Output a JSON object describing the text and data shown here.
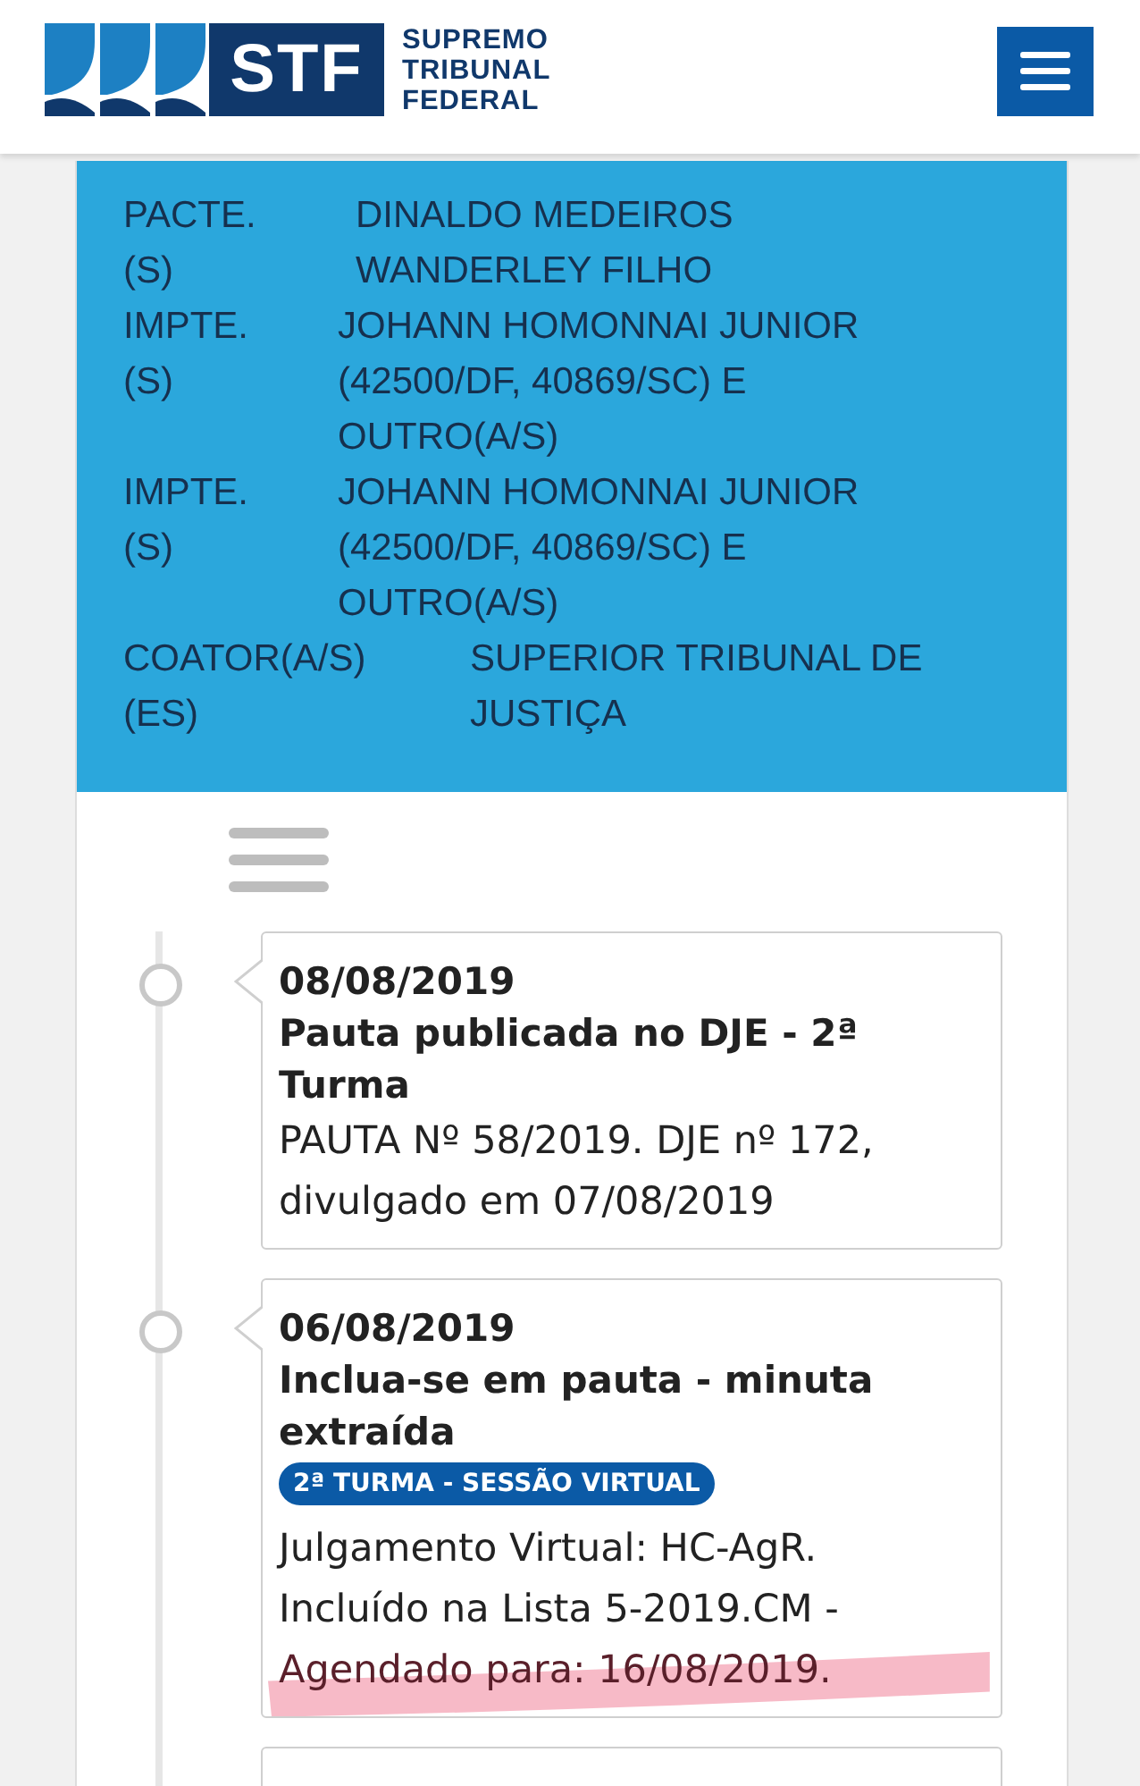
{
  "header": {
    "logo": {
      "abbr": "STF",
      "name_lines": [
        "SUPREMO",
        "TRIBUNAL",
        "FEDERAL"
      ]
    }
  },
  "parties": [
    {
      "label_lines": [
        "PACTE.",
        "(S)"
      ],
      "value_lines": [
        "DINALDO MEDEIROS",
        "WANDERLEY FILHO"
      ]
    },
    {
      "label_lines": [
        "IMPTE.",
        "(S)"
      ],
      "value_lines": [
        "JOHANN HOMONNAI JUNIOR",
        "(42500/DF, 40869/SC) E",
        "OUTRO(A/S)"
      ]
    },
    {
      "label_lines": [
        "IMPTE.",
        "(S)"
      ],
      "value_lines": [
        "JOHANN HOMONNAI JUNIOR",
        "(42500/DF, 40869/SC) E",
        "OUTRO(A/S)"
      ]
    },
    {
      "label_lines": [
        "COATOR(A/S)",
        "(ES)"
      ],
      "value_lines": [
        "SUPERIOR TRIBUNAL DE",
        "JUSTIÇA"
      ]
    }
  ],
  "events": [
    {
      "date": "08/08/2019",
      "title": "Pauta publicada no DJE - 2ª Turma",
      "lines": [
        {
          "text": "PAUTA Nº 58/2019. DJE nº 172,",
          "highlighted": false
        },
        {
          "text": "divulgado em 07/08/2019",
          "highlighted": false
        }
      ]
    },
    {
      "date": "06/08/2019",
      "title": "Inclua-se em pauta - minuta extraída",
      "badge": "2ª TURMA - SESSÃO VIRTUAL",
      "lines": [
        {
          "text": "Julgamento Virtual: HC-AgR.",
          "highlighted": false
        },
        {
          "text": "Incluído na Lista 5-2019.CM -",
          "highlighted": false
        },
        {
          "text": "Agendado para: 16/08/2019.",
          "highlighted": true
        }
      ]
    }
  ]
}
